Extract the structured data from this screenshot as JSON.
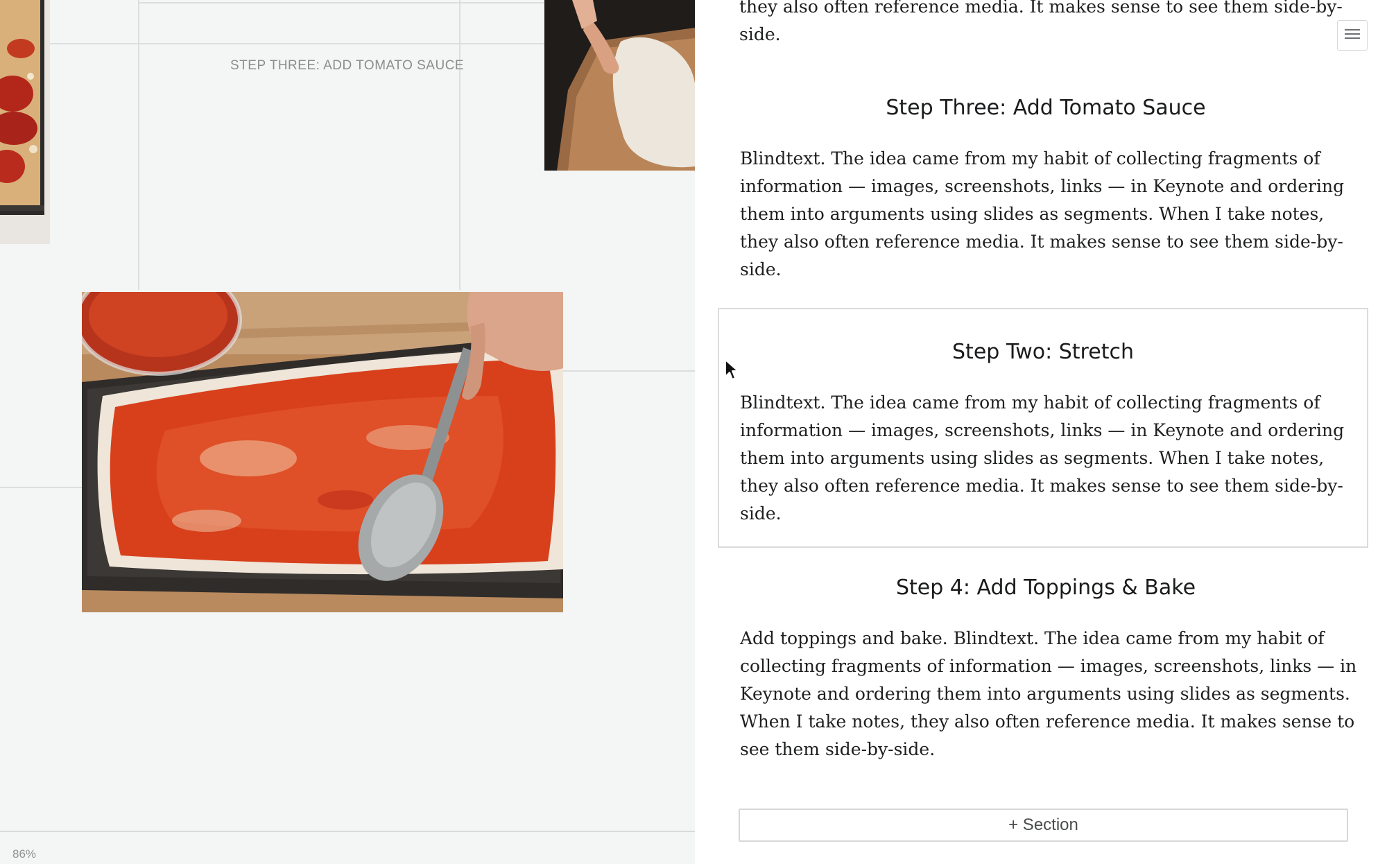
{
  "canvas": {
    "label": "STEP THREE: ADD TOMATO SAUCE",
    "zoom": "86%"
  },
  "editor": {
    "menu_icon": "hamburger-icon",
    "previous_text": "they also often reference media. It makes sense to see them side-by-side.",
    "sections": [
      {
        "heading": "Step Three: Add Tomato Sauce",
        "body": "Blindtext. The idea came from my habit of collecting fragments of information — images, screenshots, links — in Keynote and ordering them into arguments using slides as segments. When I take notes, they also often reference media. It makes sense to see them side-by-side."
      },
      {
        "heading": "Step Two: Stretch",
        "body": "Blindtext. The idea came from my habit of collecting fragments of information — images, screenshots, links — in Keynote and ordering them into arguments using slides as segments. When I take notes, they also often reference media. It makes sense to see them side-by-side."
      },
      {
        "heading": "Step 4: Add Toppings & Bake",
        "body": "Add toppings and bake. Blindtext. The idea came from my habit of collecting fragments of information — images, screenshots, links — in Keynote and ordering them into arguments using slides as segments. When I take notes, they also often reference media. It makes sense to see them side-by-side."
      }
    ],
    "add_section_label": "+ Section"
  },
  "colors": {
    "canvas_bg": "#f4f5f5",
    "grid_line": "#dcdede",
    "sauce": "#d8401c",
    "border": "#d9dbdc"
  }
}
